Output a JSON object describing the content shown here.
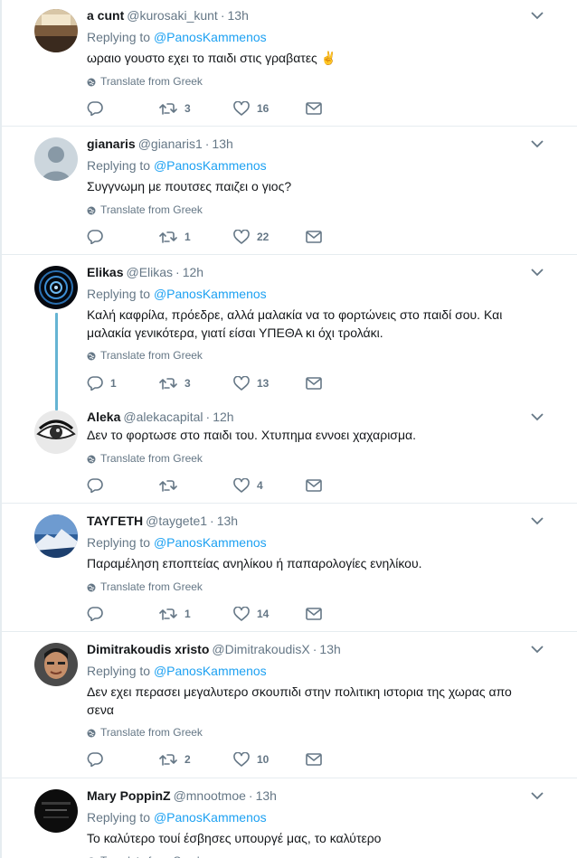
{
  "translate_label": "Translate from Greek",
  "replying_prefix": "Replying to",
  "tweets": [
    {
      "name": "a cunt",
      "handle": "@kurosaki_kunt",
      "time": "13h",
      "replying_to": "@PanosKammenos",
      "text": "ωραιο γουστο εχει το παιδι στις γραβατες ✌️",
      "replies": "",
      "retweets": "3",
      "likes": "16"
    },
    {
      "name": "gianaris",
      "handle": "@gianaris1",
      "time": "13h",
      "replying_to": "@PanosKammenos",
      "text": "Συγγνωμη με πουτσες παιζει ο γιος?",
      "replies": "",
      "retweets": "1",
      "likes": "22"
    },
    {
      "name": "Elikas",
      "handle": "@Elikas",
      "time": "12h",
      "replying_to": "@PanosKammenos",
      "text": "Καλή καφρίλα, πρόεδρε, αλλά μαλακία να το φορτώνεις στο παιδί σου. Και μαλακία γενικότερα, γιατί είσαι ΥΠΕΘΑ κι όχι τρολάκι.",
      "replies": "1",
      "retweets": "3",
      "likes": "13"
    },
    {
      "name": "Aleka",
      "handle": "@alekacapital",
      "time": "12h",
      "replying_to": "",
      "text": "Δεν το φορτωσε στο παιδι του. Χτυπημα εννοει χαχαρισμα.",
      "replies": "",
      "retweets": "",
      "likes": "4"
    },
    {
      "name": "ΤΑΥΓΕΤΗ",
      "handle": "@taygete1",
      "time": "13h",
      "replying_to": "@PanosKammenos",
      "text": "Παραμέληση εποπτείας ανηλίκου ή παπαρολογίες ενηλίκου.",
      "replies": "",
      "retweets": "1",
      "likes": "14"
    },
    {
      "name": "Dimitrakoudis xristo",
      "handle": "@DimitrakoudisX",
      "time": "13h",
      "replying_to": "@PanosKammenos",
      "text": "Δεν εχει περασει μεγαλυτερο σκουπιδι στην πολιτικη ιστορια της χωρας απο σενα",
      "replies": "",
      "retweets": "2",
      "likes": "10"
    },
    {
      "name": "Mary PoppinZ",
      "handle": "@mnootmoe",
      "time": "13h",
      "replying_to": "@PanosKammenos",
      "text": "Το καλύτερο τουί έσβησες υπουργέ μας, το καλύτερο",
      "replies": "",
      "retweets": "",
      "likes": ""
    }
  ],
  "colors": {
    "link": "#1da1f2",
    "muted": "#657786",
    "text": "#14171a",
    "divider": "#e6ecf0",
    "thread_line": "#65b4d3"
  },
  "icons": [
    "reply-icon",
    "retweet-icon",
    "like-icon",
    "direct-message-icon",
    "globe-icon",
    "chevron-down-icon"
  ]
}
